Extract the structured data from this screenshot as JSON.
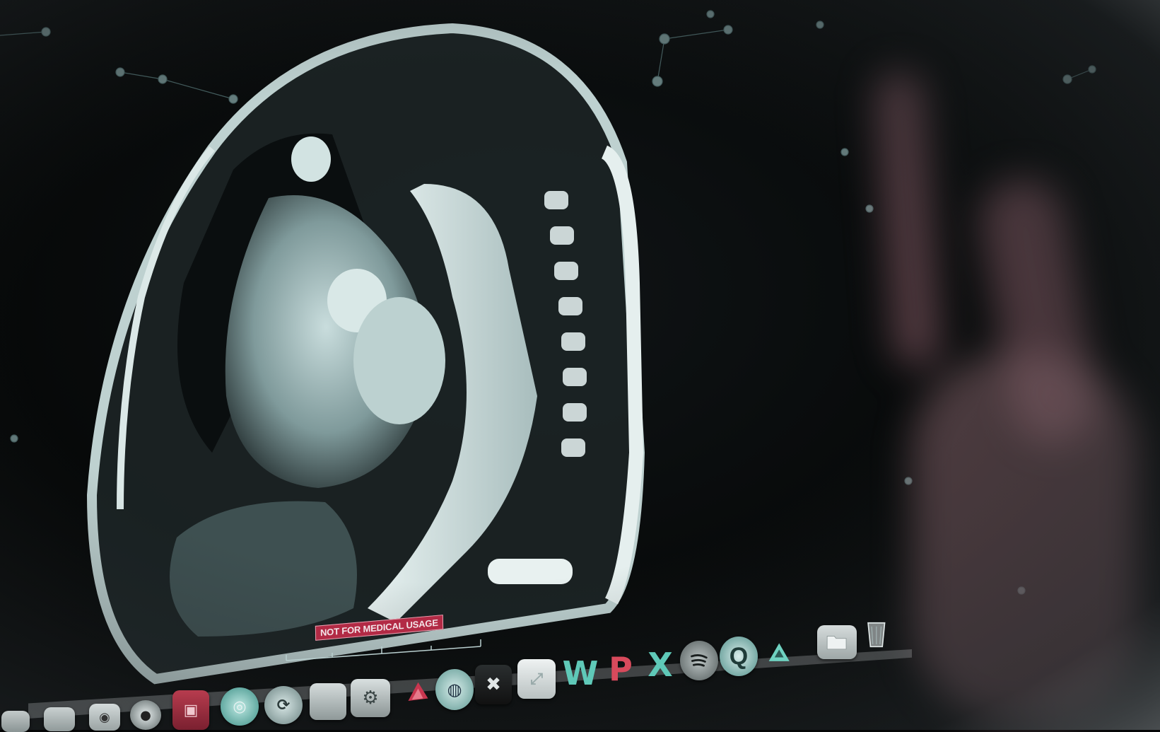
{
  "screen": {
    "content": "mri-sagittal-chest-scan",
    "warning_label": "NOT FOR MEDICAL USAGE"
  },
  "dock": {
    "items": [
      {
        "name": "dock-item-1",
        "icon": "app-icon"
      },
      {
        "name": "dock-item-2",
        "icon": "app-icon"
      },
      {
        "name": "dock-item-3",
        "icon": "photo-booth-icon"
      },
      {
        "name": "dock-item-4",
        "icon": "camera-icon"
      },
      {
        "name": "dock-item-5",
        "icon": "photo-icon"
      },
      {
        "name": "dock-item-6",
        "icon": "circle-app-icon"
      },
      {
        "name": "dock-item-7",
        "icon": "sync-icon"
      },
      {
        "name": "dock-item-8",
        "icon": "app-icon"
      },
      {
        "name": "dock-item-9",
        "icon": "settings-icon"
      },
      {
        "name": "dock-item-10",
        "icon": "matlab-icon"
      },
      {
        "name": "dock-item-11",
        "icon": "globe-icon"
      },
      {
        "name": "dock-item-12",
        "icon": "tools-icon"
      },
      {
        "name": "dock-item-13",
        "icon": "preview-icon"
      },
      {
        "name": "dock-item-word",
        "icon": "word-icon",
        "glyph": "W"
      },
      {
        "name": "dock-item-powerpoint",
        "icon": "powerpoint-icon",
        "glyph": "P"
      },
      {
        "name": "dock-item-excel",
        "icon": "excel-icon",
        "glyph": "X"
      },
      {
        "name": "dock-item-spotify",
        "icon": "spotify-icon"
      },
      {
        "name": "dock-item-quicktime",
        "icon": "quicktime-icon",
        "glyph": "Q"
      },
      {
        "name": "dock-item-triangle",
        "icon": "triangle-app-icon"
      },
      {
        "name": "dock-item-folder",
        "icon": "folder-icon"
      },
      {
        "name": "dock-item-trash",
        "icon": "trash-icon"
      }
    ]
  },
  "colors": {
    "warning_bg": "#b22a45",
    "tint": "#9fdede",
    "office_accent": "#5fc9b8",
    "powerpoint_accent": "#d84a5c"
  }
}
